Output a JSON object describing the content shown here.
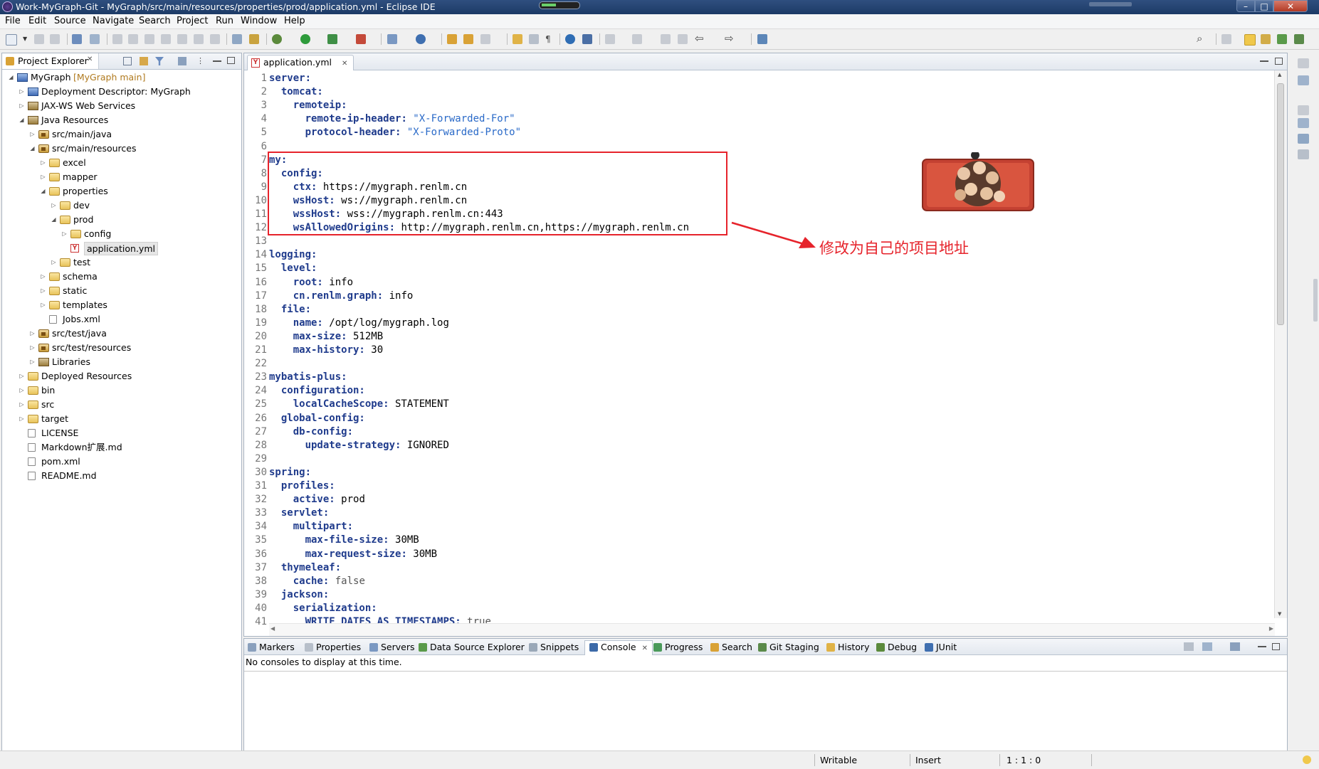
{
  "window": {
    "title": "Work-MyGraph-Git - MyGraph/src/main/resources/properties/prod/application.yml - Eclipse IDE",
    "controls": [
      "–",
      "□",
      "✕"
    ]
  },
  "menu": [
    "File",
    "Edit",
    "Source",
    "Navigate",
    "Search",
    "Project",
    "Run",
    "Window",
    "Help"
  ],
  "explorer": {
    "title": "Project Explorer",
    "close": "✕",
    "tree": [
      {
        "label": "MyGraph",
        "suffix": " [MyGraph main]",
        "depth": 0,
        "state": "open",
        "icon": "project"
      },
      {
        "label": "Deployment Descriptor: MyGraph",
        "depth": 1,
        "state": "closed",
        "icon": "descriptor"
      },
      {
        "label": "JAX-WS Web Services",
        "depth": 1,
        "state": "closed",
        "icon": "webservice"
      },
      {
        "label": "Java Resources",
        "depth": 1,
        "state": "open",
        "icon": "javares"
      },
      {
        "label": "src/main/java",
        "depth": 2,
        "state": "closed",
        "icon": "pkgfolder"
      },
      {
        "label": "src/main/resources",
        "depth": 2,
        "state": "open",
        "icon": "pkgfolder"
      },
      {
        "label": "excel",
        "depth": 3,
        "state": "closed",
        "icon": "folder"
      },
      {
        "label": "mapper",
        "depth": 3,
        "state": "closed",
        "icon": "folder"
      },
      {
        "label": "properties",
        "depth": 3,
        "state": "open",
        "icon": "folder"
      },
      {
        "label": "dev",
        "depth": 4,
        "state": "closed",
        "icon": "folder"
      },
      {
        "label": "prod",
        "depth": 4,
        "state": "open",
        "icon": "folder"
      },
      {
        "label": "config",
        "depth": 5,
        "state": "closed",
        "icon": "folder"
      },
      {
        "label": "application.yml",
        "depth": 5,
        "state": "none",
        "icon": "yml",
        "selected": true
      },
      {
        "label": "test",
        "depth": 4,
        "state": "closed",
        "icon": "folder"
      },
      {
        "label": "schema",
        "depth": 3,
        "state": "closed",
        "icon": "folder"
      },
      {
        "label": "static",
        "depth": 3,
        "state": "closed",
        "icon": "folder"
      },
      {
        "label": "templates",
        "depth": 3,
        "state": "closed",
        "icon": "folder"
      },
      {
        "label": "Jobs.xml",
        "depth": 3,
        "state": "none",
        "icon": "xmlfile"
      },
      {
        "label": "src/test/java",
        "depth": 2,
        "state": "closed",
        "icon": "pkgfolder"
      },
      {
        "label": "src/test/resources",
        "depth": 2,
        "state": "closed",
        "icon": "pkgfolder"
      },
      {
        "label": "Libraries",
        "depth": 2,
        "state": "closed",
        "icon": "library"
      },
      {
        "label": "Deployed Resources",
        "depth": 1,
        "state": "closed",
        "icon": "folder"
      },
      {
        "label": "bin",
        "depth": 1,
        "state": "closed",
        "icon": "folder"
      },
      {
        "label": "src",
        "depth": 1,
        "state": "closed",
        "icon": "folder"
      },
      {
        "label": "target",
        "depth": 1,
        "state": "closed",
        "icon": "folder"
      },
      {
        "label": "LICENSE",
        "depth": 1,
        "state": "none",
        "icon": "file"
      },
      {
        "label": "Markdown扩展.md",
        "depth": 1,
        "state": "none",
        "icon": "file"
      },
      {
        "label": "pom.xml",
        "depth": 1,
        "state": "none",
        "icon": "xmlfile"
      },
      {
        "label": "README.md",
        "depth": 1,
        "state": "none",
        "icon": "file"
      }
    ]
  },
  "editor": {
    "tab_label": "application.yml",
    "tab_close": "✕",
    "lines": [
      {
        "n": "1",
        "indent": "",
        "key": "server:",
        "val": "",
        "type": ""
      },
      {
        "n": "2",
        "indent": "  ",
        "key": "tomcat:",
        "val": "",
        "type": ""
      },
      {
        "n": "3",
        "indent": "    ",
        "key": "remoteip:",
        "val": "",
        "type": ""
      },
      {
        "n": "4",
        "indent": "      ",
        "key": "remote-ip-header:",
        "val": " \"X-Forwarded-For\"",
        "type": "s"
      },
      {
        "n": "5",
        "indent": "      ",
        "key": "protocol-header:",
        "val": " \"X-Forwarded-Proto\"",
        "type": "s"
      },
      {
        "n": "6",
        "indent": "",
        "key": "",
        "val": "",
        "type": ""
      },
      {
        "n": "7",
        "indent": "",
        "key": "my:",
        "val": "",
        "type": ""
      },
      {
        "n": "8",
        "indent": "  ",
        "key": "config:",
        "val": "",
        "type": ""
      },
      {
        "n": "9",
        "indent": "    ",
        "key": "ctx:",
        "val": " https://mygraph.renlm.cn",
        "type": ""
      },
      {
        "n": "10",
        "indent": "    ",
        "key": "wsHost:",
        "val": " ws://mygraph.renlm.cn",
        "type": ""
      },
      {
        "n": "11",
        "indent": "    ",
        "key": "wssHost:",
        "val": " wss://mygraph.renlm.cn:443",
        "type": ""
      },
      {
        "n": "12",
        "indent": "    ",
        "key": "wsAllowedOrigins:",
        "val": " http://mygraph.renlm.cn,https://mygraph.renlm.cn",
        "type": ""
      },
      {
        "n": "13",
        "indent": "",
        "key": "",
        "val": "",
        "type": ""
      },
      {
        "n": "14",
        "indent": "",
        "key": "logging:",
        "val": "",
        "type": ""
      },
      {
        "n": "15",
        "indent": "  ",
        "key": "level:",
        "val": "",
        "type": ""
      },
      {
        "n": "16",
        "indent": "    ",
        "key": "root:",
        "val": " info",
        "type": ""
      },
      {
        "n": "17",
        "indent": "    ",
        "key": "cn.renlm.graph:",
        "val": " info",
        "type": ""
      },
      {
        "n": "18",
        "indent": "  ",
        "key": "file:",
        "val": "",
        "type": ""
      },
      {
        "n": "19",
        "indent": "    ",
        "key": "name:",
        "val": " /opt/log/mygraph.log",
        "type": ""
      },
      {
        "n": "20",
        "indent": "    ",
        "key": "max-size:",
        "val": " 512MB",
        "type": ""
      },
      {
        "n": "21",
        "indent": "    ",
        "key": "max-history:",
        "val": " 30",
        "type": ""
      },
      {
        "n": "22",
        "indent": "",
        "key": "",
        "val": "",
        "type": ""
      },
      {
        "n": "23",
        "indent": "",
        "key": "mybatis-plus:",
        "val": "",
        "type": ""
      },
      {
        "n": "24",
        "indent": "  ",
        "key": "configuration:",
        "val": "",
        "type": ""
      },
      {
        "n": "25",
        "indent": "    ",
        "key": "localCacheScope:",
        "val": " STATEMENT",
        "type": ""
      },
      {
        "n": "26",
        "indent": "  ",
        "key": "global-config:",
        "val": "",
        "type": ""
      },
      {
        "n": "27",
        "indent": "    ",
        "key": "db-config:",
        "val": "",
        "type": ""
      },
      {
        "n": "28",
        "indent": "      ",
        "key": "update-strategy:",
        "val": " IGNORED",
        "type": ""
      },
      {
        "n": "29",
        "indent": "",
        "key": "",
        "val": "",
        "type": ""
      },
      {
        "n": "30",
        "indent": "",
        "key": "spring:",
        "val": "",
        "type": ""
      },
      {
        "n": "31",
        "indent": "  ",
        "key": "profiles:",
        "val": "",
        "type": ""
      },
      {
        "n": "32",
        "indent": "    ",
        "key": "active:",
        "val": " prod",
        "type": ""
      },
      {
        "n": "33",
        "indent": "  ",
        "key": "servlet:",
        "val": "",
        "type": ""
      },
      {
        "n": "34",
        "indent": "    ",
        "key": "multipart:",
        "val": "",
        "type": ""
      },
      {
        "n": "35",
        "indent": "      ",
        "key": "max-file-size:",
        "val": " 30MB",
        "type": ""
      },
      {
        "n": "36",
        "indent": "      ",
        "key": "max-request-size:",
        "val": " 30MB",
        "type": ""
      },
      {
        "n": "37",
        "indent": "  ",
        "key": "thymeleaf:",
        "val": "",
        "type": ""
      },
      {
        "n": "38",
        "indent": "    ",
        "key": "cache:",
        "val": " false",
        "type": "b"
      },
      {
        "n": "39",
        "indent": "  ",
        "key": "jackson:",
        "val": "",
        "type": ""
      },
      {
        "n": "40",
        "indent": "    ",
        "key": "serialization:",
        "val": "",
        "type": ""
      },
      {
        "n": "41",
        "indent": "      ",
        "key": "WRITE_DATES_AS_TIMESTAMPS:",
        "val": " true",
        "type": "b"
      }
    ]
  },
  "annotation": {
    "note": "修改为自己的项目地址",
    "color": "#e6232b"
  },
  "console": {
    "tabs": [
      "Markers",
      "Properties",
      "Servers",
      "Data Source Explorer",
      "Snippets",
      "Console",
      "Progress",
      "Search",
      "Git Staging",
      "History",
      "Debug",
      "JUnit"
    ],
    "active_tab": "Console",
    "close": "✕",
    "message": "No consoles to display at this time."
  },
  "status": {
    "writable": "Writable",
    "insert": "Insert",
    "position": "1 : 1 : 0"
  }
}
